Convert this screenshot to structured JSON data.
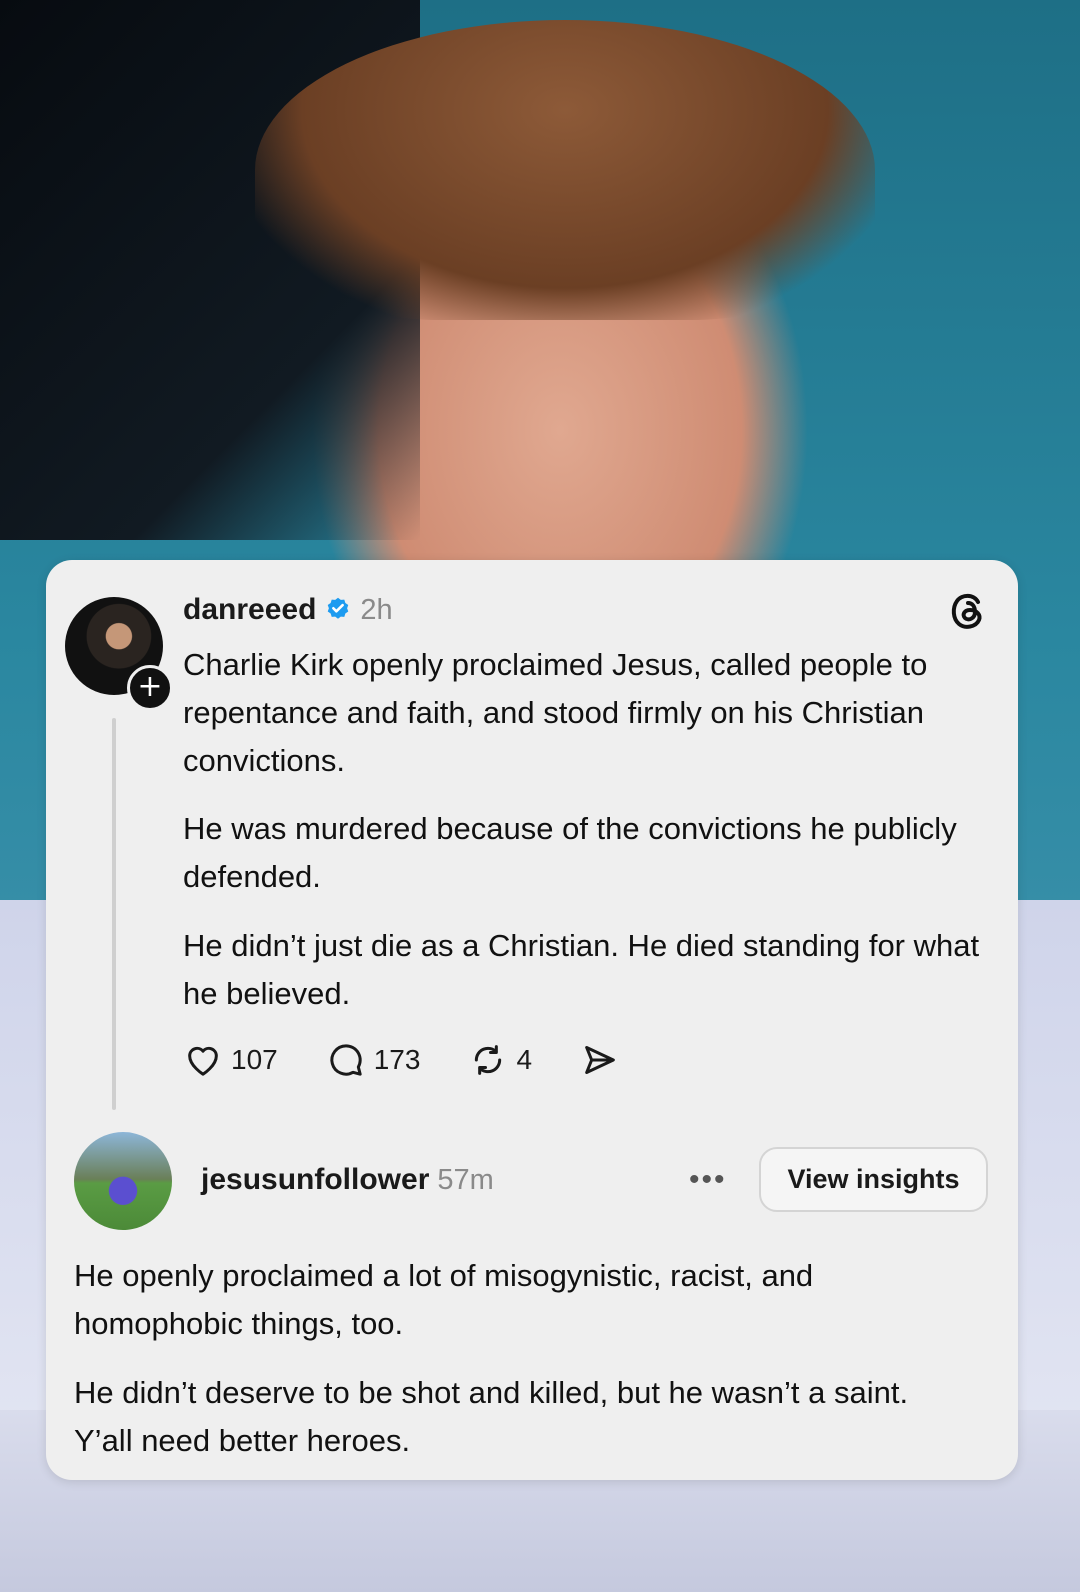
{
  "post": {
    "username": "danreeed",
    "time": "2h",
    "paragraphs": [
      "Charlie Kirk openly proclaimed Jesus, called people to repentance and faith, and stood firmly on his Christian convictions.",
      "He was murdered because of the convictions he publicly defended.",
      "He didn’t just die as a Christian. He died standing for what he believed."
    ],
    "likes": "107",
    "replies": "173",
    "reposts": "4"
  },
  "reply": {
    "username": "jesusunfollower",
    "time": "57m",
    "insights_label": "View insights",
    "paragraphs": [
      "He openly proclaimed a lot of misogynistic, racist, and homophobic things, too.",
      "He didn’t deserve to be shot and killed, but he wasn’t a saint. Y’all need better heroes."
    ]
  },
  "icons": {
    "verified": "verified-badge-icon",
    "app": "threads-logo-icon",
    "like": "heart-icon",
    "comment": "comment-icon",
    "repost": "repost-icon",
    "share": "send-icon",
    "more": "more-icon"
  },
  "colors": {
    "card": "#efefef",
    "verified": "#1d9bf0",
    "muted_text": "#8a8a8a"
  }
}
